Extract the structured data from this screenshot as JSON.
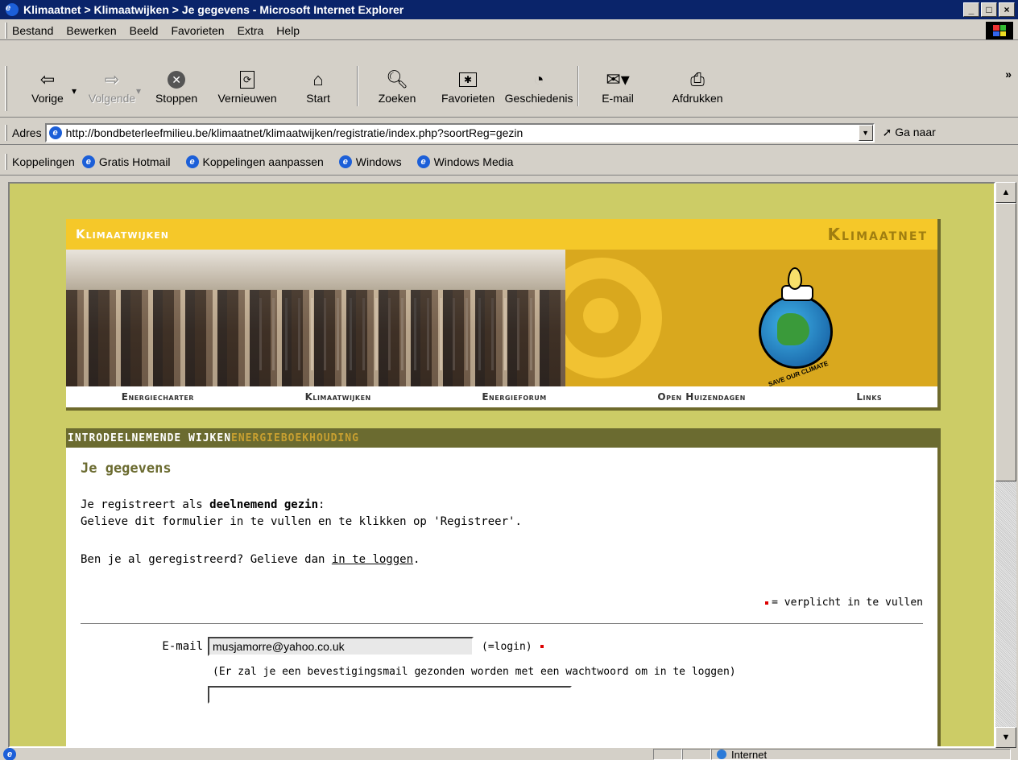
{
  "window": {
    "title": "Klimaatnet > Klimaatwijken > Je gegevens - Microsoft Internet Explorer",
    "buttons": [
      "_",
      "□",
      "×"
    ]
  },
  "menu": [
    "Bestand",
    "Bewerken",
    "Beeld",
    "Favorieten",
    "Extra",
    "Help"
  ],
  "toolbar": {
    "back": "Vorige",
    "forward": "Volgende",
    "stop": "Stoppen",
    "refresh": "Vernieuwen",
    "home": "Start",
    "search": "Zoeken",
    "favorites": "Favorieten",
    "history": "Geschiedenis",
    "mail": "E-mail",
    "print": "Afdrukken",
    "more": "»"
  },
  "address": {
    "label": "Adres",
    "url": "http://bondbeterleefmilieu.be/klimaatnet/klimaatwijken/registratie/index.php?soortReg=gezin",
    "go": "Ga naar"
  },
  "links": {
    "label": "Koppelingen",
    "items": [
      "Gratis Hotmail",
      "Koppelingen aanpassen",
      "Windows",
      "Windows Media"
    ]
  },
  "site": {
    "brand_left": "Klimaatwijken",
    "brand_right": "Klimaatnet",
    "logo_caption": "SAVE OUR CLIMATE",
    "nav": [
      "Energiecharter",
      "Klimaatwijken",
      "Energieforum",
      "Open Huizendagen",
      "Links"
    ],
    "tabs": {
      "intro": "INTRO",
      "wijken": "DEELNEMENDE WIJKEN",
      "boekhouding": "ENERGIEBOEKHOUDING"
    }
  },
  "content": {
    "title": "Je gegevens",
    "line1_pre": "Je registreert als ",
    "line1_bold": "deelnemend gezin",
    "line1_post": ":",
    "line2": "Gelieve dit formulier in te vullen en te klikken op 'Registreer'.",
    "line3_pre": "Ben je al geregistreerd? Gelieve dan ",
    "line3_link": "in te loggen",
    "line3_post": ".",
    "required_note": "= verplicht in te vullen",
    "form": {
      "email_label": "E-mail",
      "email_value": "musjamorre@yahoo.co.uk",
      "email_hint": "(=login)",
      "email_note": "(Er zal je een bevestigingsmail gezonden worden met een wachtwoord om in te loggen)"
    }
  },
  "status": {
    "zone": "Internet"
  }
}
